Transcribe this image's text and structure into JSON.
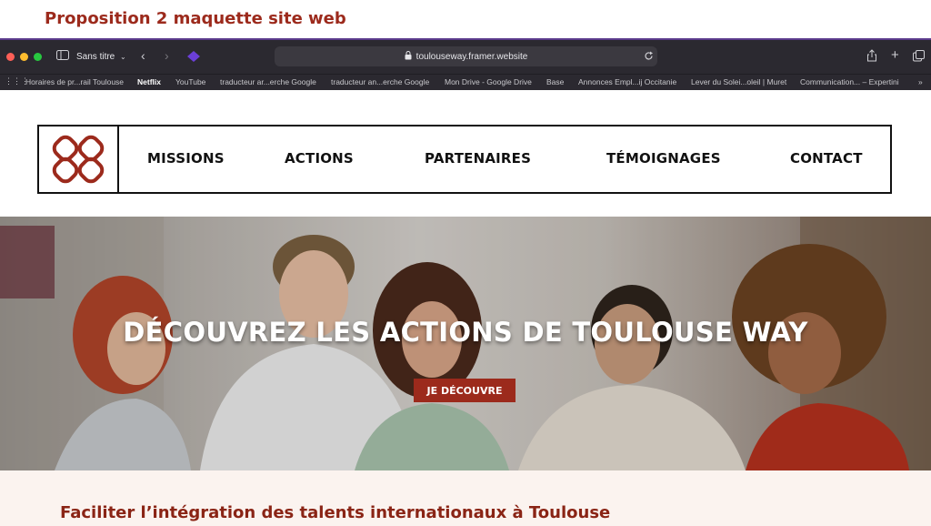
{
  "slide": {
    "title": "Proposition 2 maquette site web"
  },
  "browser": {
    "tab_title": "Sans titre",
    "url": "toulouseway.framer.website",
    "bookmarks": [
      "Horaires de pr...rail Toulouse",
      "Netflix",
      "YouTube",
      "traducteur ar...erche Google",
      "traducteur an...erche Google",
      "Mon Drive - Google Drive",
      "Base",
      "Annonces Empl...ij Occitanie",
      "Lever du Solei...oleil | Muret",
      "Communication... – Expertini"
    ]
  },
  "nav": {
    "items": [
      "MISSIONS",
      "ACTIONS",
      "PARTENAIRES",
      "TÉMOIGNAGES",
      "CONTACT"
    ]
  },
  "hero": {
    "headline": "DÉCOUVREZ LES ACTIONS DE TOULOUSE WAY",
    "cta_label": "JE DÉCOUVRE"
  },
  "section": {
    "tagline": "Faciliter l’intégration des talents internationaux à Toulouse"
  },
  "colors": {
    "brand_red": "#9c2a1c",
    "browser_chrome": "#2b2930",
    "nav_border": "#111111"
  }
}
